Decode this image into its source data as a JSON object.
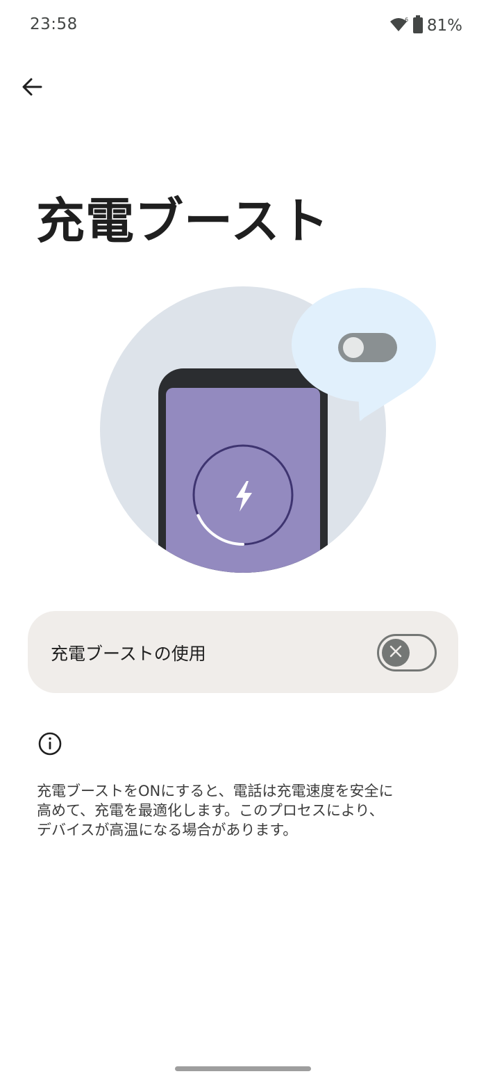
{
  "status_bar": {
    "time": "23:58",
    "battery_text": "81%",
    "icons": [
      "wifi-icon",
      "battery-icon"
    ]
  },
  "navigation": {
    "back_icon": "arrow-back-icon"
  },
  "page": {
    "title": "充電ブースト"
  },
  "illustration": {
    "description_icons": [
      "phone-icon",
      "bolt-icon",
      "toggle-icon",
      "speech-bubble-icon"
    ],
    "colors": {
      "circle_bg": "#dde3ea",
      "phone_body": "#2b2d30",
      "phone_screen": "#938abf",
      "ring": "#3e3470",
      "bubble": "#e1f0fc",
      "toggle": "#8a9092"
    }
  },
  "setting": {
    "label": "充電ブーストの使用",
    "enabled": false
  },
  "info": {
    "icon": "info-icon",
    "text": "充電ブーストをONにすると、電話は充電速度を安全に\n高めて、充電を最適化します。このプロセスにより、\nデバイスが高温になる場合があります。"
  },
  "colors": {
    "background": "#ffffff",
    "card": "#f0edea",
    "switch_off": "#747775",
    "text": "#1f1f1f"
  }
}
